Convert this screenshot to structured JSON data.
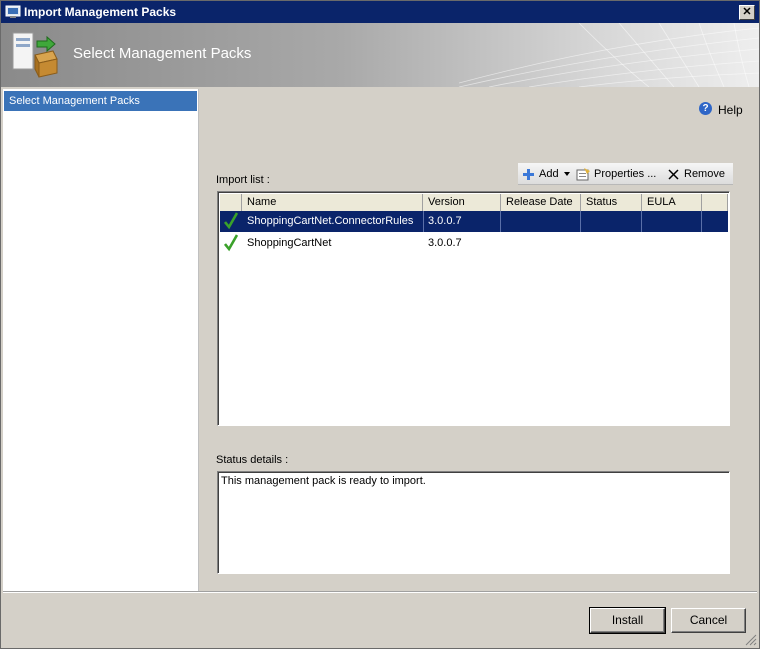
{
  "window": {
    "title": "Import Management Packs",
    "close_glyph": "✕"
  },
  "banner": {
    "title": "Select Management Packs"
  },
  "sidebar": {
    "items": [
      {
        "label": "Select Management Packs",
        "selected": true
      }
    ]
  },
  "help": {
    "label": "Help",
    "icon": "help-icon"
  },
  "import_list": {
    "label": "Import list :",
    "toolbar": {
      "add_label": "Add",
      "properties_label": "Properties ...",
      "remove_label": "Remove"
    },
    "columns": [
      "Name",
      "Version",
      "Release Date",
      "Status",
      "EULA"
    ],
    "rows": [
      {
        "name": "ShoppingCartNet.ConnectorRules",
        "version": "3.0.0.7",
        "release_date": "",
        "status": "",
        "eula": "",
        "selected": true
      },
      {
        "name": "ShoppingCartNet",
        "version": "3.0.0.7",
        "release_date": "",
        "status": "",
        "eula": "",
        "selected": false
      }
    ]
  },
  "status_details": {
    "label": "Status details :",
    "text": "This management pack is ready to import."
  },
  "buttons": {
    "install_label": "Install",
    "cancel_label": "Cancel"
  },
  "colors": {
    "title_bar": "#0a246a",
    "selection": "#0a246a",
    "sidebar_selection": "#3a73b8",
    "check": "#3aa12a"
  }
}
